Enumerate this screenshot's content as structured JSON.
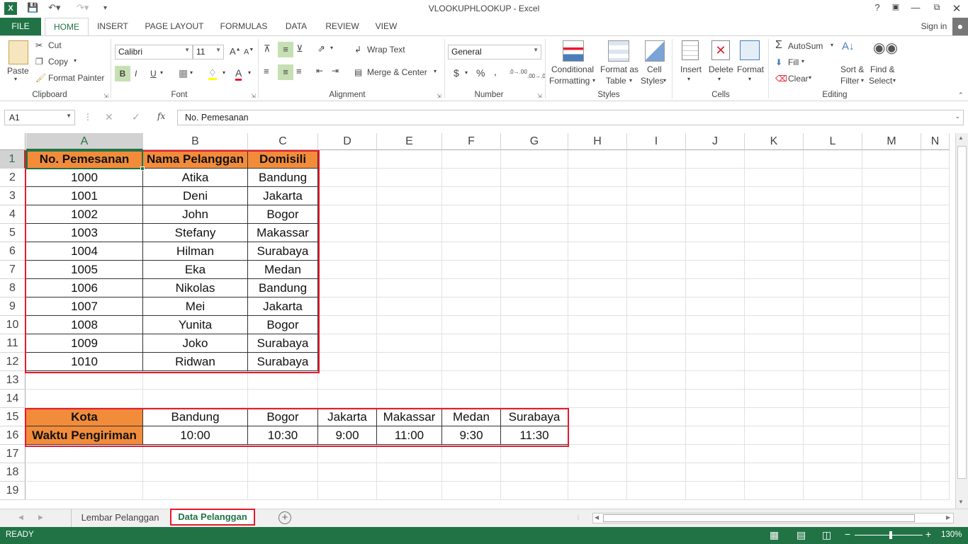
{
  "window": {
    "title": "VLOOKUPHLOOKUP - Excel",
    "sign_in": "Sign in",
    "help": "?"
  },
  "tabs": [
    "FILE",
    "HOME",
    "INSERT",
    "PAGE LAYOUT",
    "FORMULAS",
    "DATA",
    "REVIEW",
    "VIEW"
  ],
  "ribbon": {
    "clipboard": {
      "paste": "Paste",
      "cut": "Cut",
      "copy": "Copy",
      "format_painter": "Format Painter",
      "label": "Clipboard"
    },
    "font": {
      "name": "Calibri",
      "size": "11",
      "bold": "B",
      "italic": "I",
      "underline": "U",
      "label": "Font"
    },
    "alignment": {
      "wrap_text": "Wrap Text",
      "merge_center": "Merge & Center",
      "label": "Alignment"
    },
    "number": {
      "format": "General",
      "currency": "$",
      "percent": "%",
      "comma": ",",
      "inc_dec": ".0→.00",
      "dec_dec": ".00→.0",
      "label": "Number"
    },
    "styles": {
      "conditional": "Conditional",
      "conditional2": "Formatting",
      "format_as": "Format as",
      "format_as2": "Table",
      "cell": "Cell",
      "cell2": "Styles",
      "label": "Styles"
    },
    "cells": {
      "insert": "Insert",
      "delete": "Delete",
      "format": "Format",
      "label": "Cells"
    },
    "editing": {
      "autosum": "AutoSum",
      "fill": "Fill",
      "clear": "Clear",
      "sort": "Sort &",
      "sort2": "Filter",
      "find": "Find &",
      "find2": "Select",
      "label": "Editing"
    }
  },
  "formula_bar": {
    "name_box": "A1",
    "fx": "fx",
    "formula": "No. Pemesanan"
  },
  "columns": [
    "A",
    "B",
    "C",
    "D",
    "E",
    "F",
    "G",
    "H",
    "I",
    "J",
    "K",
    "L",
    "M",
    "N"
  ],
  "rows": [
    "1",
    "2",
    "3",
    "4",
    "5",
    "6",
    "7",
    "8",
    "9",
    "10",
    "11",
    "12",
    "13",
    "14",
    "15",
    "16",
    "17",
    "18",
    "19"
  ],
  "table1": {
    "headers": [
      "No. Pemesanan",
      "Nama Pelanggan",
      "Domisili"
    ],
    "rows": [
      [
        "1000",
        "Atika",
        "Bandung"
      ],
      [
        "1001",
        "Deni",
        "Jakarta"
      ],
      [
        "1002",
        "John",
        "Bogor"
      ],
      [
        "1003",
        "Stefany",
        "Makassar"
      ],
      [
        "1004",
        "Hilman",
        "Surabaya"
      ],
      [
        "1005",
        "Eka",
        "Medan"
      ],
      [
        "1006",
        "Nikolas",
        "Bandung"
      ],
      [
        "1007",
        "Mei",
        "Jakarta"
      ],
      [
        "1008",
        "Yunita",
        "Bogor"
      ],
      [
        "1009",
        "Joko",
        "Surabaya"
      ],
      [
        "1010",
        "Ridwan",
        "Surabaya"
      ]
    ]
  },
  "table2": {
    "row1_label": "Kota",
    "row2_label": "Waktu Pengiriman",
    "cities": [
      "Bandung",
      "Bogor",
      "Jakarta",
      "Makassar",
      "Medan",
      "Surabaya"
    ],
    "times": [
      "10:00",
      "10:30",
      "9:00",
      "11:00",
      "9:30",
      "11:30"
    ]
  },
  "sheets": {
    "sheet1": "Lembar Pelanggan",
    "sheet2": "Data Pelanggan",
    "add": "+"
  },
  "status": {
    "ready": "READY",
    "zoom": "130%"
  },
  "colors": {
    "excel_green": "#217346",
    "header_orange": "#f28c3a",
    "highlight_red": "#e8192c"
  }
}
